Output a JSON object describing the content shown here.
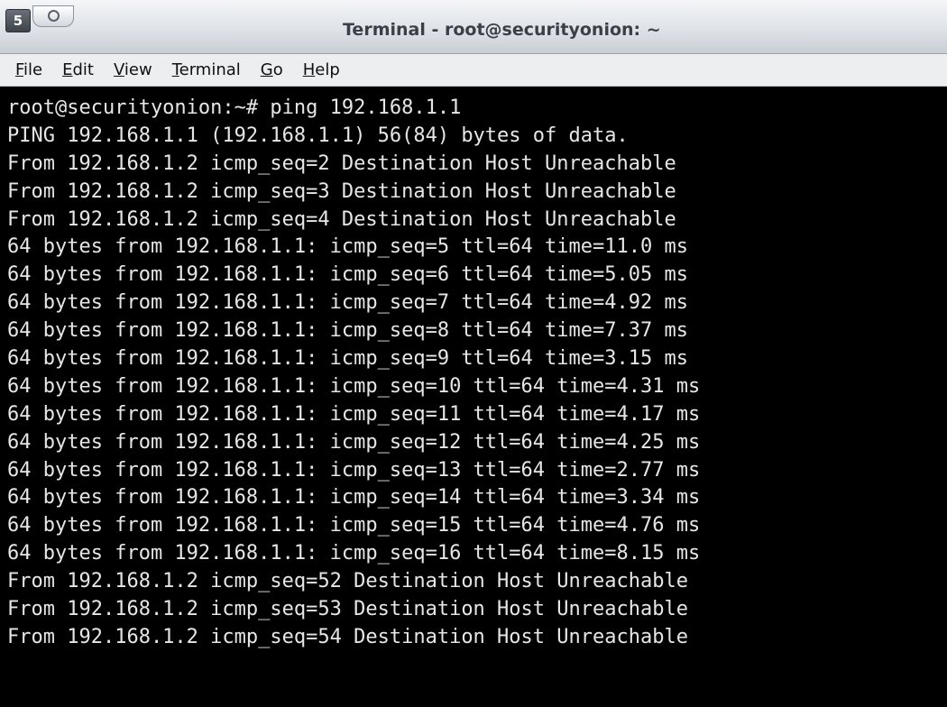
{
  "window": {
    "title": "Terminal - root@securityonion: ~",
    "menu_button_glyph": "5",
    "icons": [
      "window-menu-icon",
      "pin-icon"
    ]
  },
  "menubar": {
    "items": [
      {
        "mnemonic": "F",
        "rest": "ile"
      },
      {
        "mnemonic": "E",
        "rest": "dit"
      },
      {
        "mnemonic": "V",
        "rest": "iew"
      },
      {
        "mnemonic": "T",
        "rest": "erminal"
      },
      {
        "mnemonic": "G",
        "rest": "o"
      },
      {
        "mnemonic": "H",
        "rest": "elp"
      }
    ]
  },
  "terminal": {
    "lines": [
      "root@securityonion:~# ping 192.168.1.1",
      "PING 192.168.1.1 (192.168.1.1) 56(84) bytes of data.",
      "From 192.168.1.2 icmp_seq=2 Destination Host Unreachable",
      "From 192.168.1.2 icmp_seq=3 Destination Host Unreachable",
      "From 192.168.1.2 icmp_seq=4 Destination Host Unreachable",
      "64 bytes from 192.168.1.1: icmp_seq=5 ttl=64 time=11.0 ms",
      "64 bytes from 192.168.1.1: icmp_seq=6 ttl=64 time=5.05 ms",
      "64 bytes from 192.168.1.1: icmp_seq=7 ttl=64 time=4.92 ms",
      "64 bytes from 192.168.1.1: icmp_seq=8 ttl=64 time=7.37 ms",
      "64 bytes from 192.168.1.1: icmp_seq=9 ttl=64 time=3.15 ms",
      "64 bytes from 192.168.1.1: icmp_seq=10 ttl=64 time=4.31 ms",
      "64 bytes from 192.168.1.1: icmp_seq=11 ttl=64 time=4.17 ms",
      "64 bytes from 192.168.1.1: icmp_seq=12 ttl=64 time=4.25 ms",
      "64 bytes from 192.168.1.1: icmp_seq=13 ttl=64 time=2.77 ms",
      "64 bytes from 192.168.1.1: icmp_seq=14 ttl=64 time=3.34 ms",
      "64 bytes from 192.168.1.1: icmp_seq=15 ttl=64 time=4.76 ms",
      "64 bytes from 192.168.1.1: icmp_seq=16 ttl=64 time=8.15 ms",
      "From 192.168.1.2 icmp_seq=52 Destination Host Unreachable",
      "From 192.168.1.2 icmp_seq=53 Destination Host Unreachable",
      "From 192.168.1.2 icmp_seq=54 Destination Host Unreachable"
    ]
  },
  "colors": {
    "terminal_background": "#000000",
    "terminal_foreground": "#e6e6e6",
    "title_text": "#3b4048",
    "menubar_background": "#eceeef"
  }
}
